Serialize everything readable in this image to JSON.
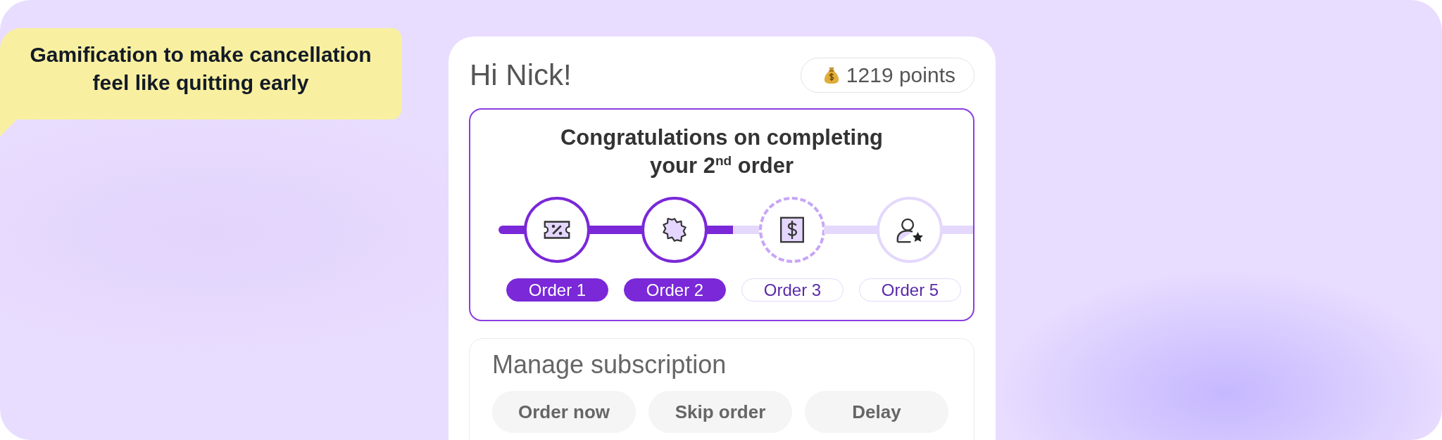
{
  "callout": {
    "text": "Gamification to make cancellation feel like quitting early"
  },
  "card": {
    "greeting": "Hi Nick!",
    "points": "1219 points",
    "progress": {
      "title": "Congratulations on completing your 2$^{nd}$ order",
      "steps": [
        {
          "label": "Order 1",
          "completed": true,
          "current": false
        },
        {
          "label": "Order 2",
          "completed": true,
          "current": false
        },
        {
          "label": "Order 3",
          "completed": false,
          "current": true
        },
        {
          "label": "Order 5",
          "completed": false,
          "current": false
        }
      ]
    },
    "manage": {
      "title": "Manage subscription",
      "buttons": [
        "Order now",
        "Skip order",
        "Delay"
      ]
    }
  }
}
